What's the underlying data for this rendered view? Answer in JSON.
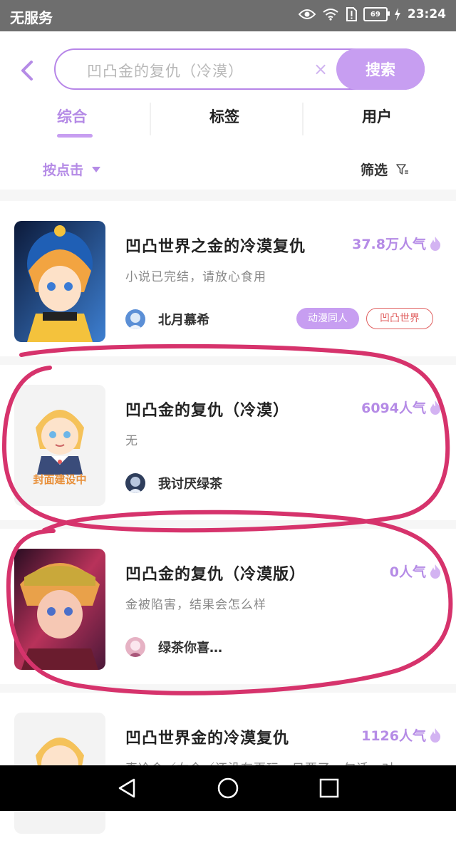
{
  "status_bar": {
    "carrier": "无服务",
    "battery": "69",
    "time": "23:24",
    "icons": [
      "eye-icon",
      "wifi-icon",
      "alert-sim-icon",
      "battery-icon",
      "charging-icon"
    ]
  },
  "search": {
    "query": "凹凸金的复仇（冷漠）",
    "clear_symbol": "×",
    "button_label": "搜索"
  },
  "tabs": [
    {
      "label": "综合",
      "active": true
    },
    {
      "label": "标签",
      "active": false
    },
    {
      "label": "用户",
      "active": false
    }
  ],
  "sort": {
    "label": "按点击"
  },
  "filter": {
    "label": "筛选"
  },
  "results": [
    {
      "title": "凹凸世界之金的冷漠复仇",
      "popularity": "37.8万人气",
      "description": "小说已完结，请放心食用",
      "author": "北月慕希",
      "tags": [
        "动漫同人",
        "凹凸世界"
      ]
    },
    {
      "title": "凹凸金的复仇（冷漠）",
      "popularity": "6094人气",
      "description": "无",
      "author": "我讨厌绿茶",
      "cover_caption": "封面建设中"
    },
    {
      "title": "凹凸金的复仇（冷漠版）",
      "popularity": "0人气",
      "description": "金被陷害，结果会怎么样",
      "author": "绿茶你喜…"
    },
    {
      "title": "凹凸世界金的冷漠复仇",
      "popularity": "1126人气",
      "description": "真冷金／女金／还没有更玩，只要了一句话，对"
    }
  ],
  "colors": {
    "accent": "#b58be6",
    "accent_fill": "#c79ef1",
    "annotation": "#d6336c",
    "status_bar": "#6e6e6e",
    "nav_bar": "#000000"
  }
}
